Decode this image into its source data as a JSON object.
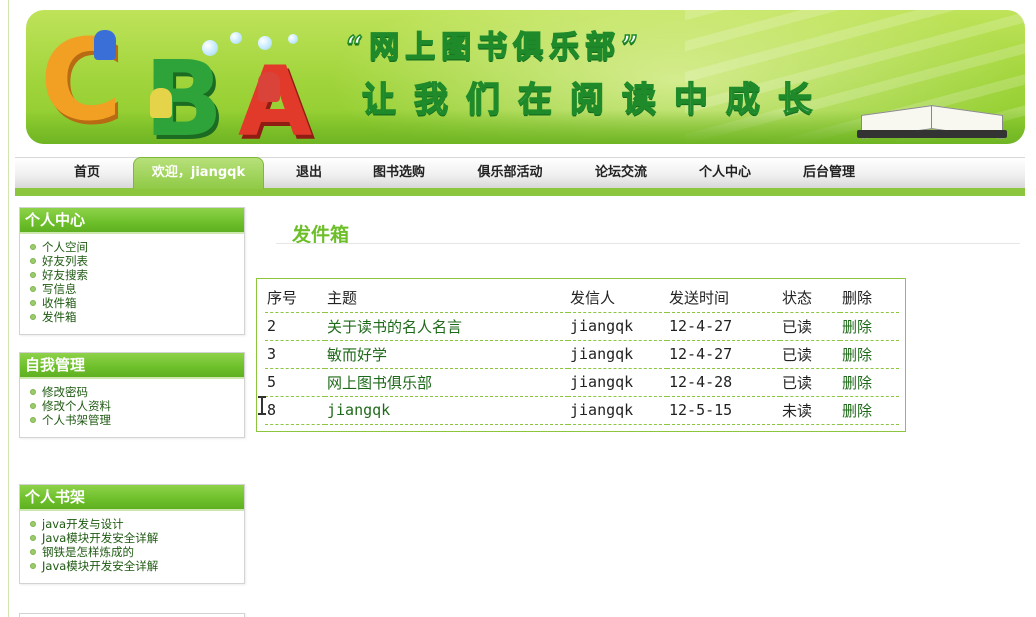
{
  "banner": {
    "title_line1": "“网上图书俱乐部”",
    "title_line2": "让我们在阅读中成长",
    "logo_letters": [
      "C",
      "B",
      "A"
    ],
    "colors": {
      "green": "#8cc63f",
      "letter_c": "#f1a023",
      "letter_b": "#2ea339",
      "letter_a": "#e23a2a"
    }
  },
  "nav": {
    "items": [
      {
        "label": "首页"
      },
      {
        "label": "欢迎，jiangqk",
        "active": true
      },
      {
        "label": "退出"
      },
      {
        "label": "图书选购"
      },
      {
        "label": "俱乐部活动"
      },
      {
        "label": "论坛交流"
      },
      {
        "label": "个人中心"
      },
      {
        "label": "后台管理"
      }
    ]
  },
  "sidebar": {
    "personal_center": {
      "title": "个人中心",
      "items": [
        "个人空间",
        "好友列表",
        "好友搜索",
        "写信息",
        "收件箱",
        "发件箱"
      ]
    },
    "self_management": {
      "title": "自我管理",
      "items": [
        "修改密码",
        "修改个人资料",
        "个人书架管理"
      ]
    },
    "bookshelf": {
      "title": "个人书架",
      "items": [
        "java开发与设计",
        "Java模块开发安全详解",
        "钢铁是怎样炼成的",
        "Java模块开发安全详解"
      ]
    }
  },
  "main": {
    "title": "发件箱",
    "table": {
      "headers": [
        "序号",
        "主题",
        "发信人",
        "发送时间",
        "状态",
        "删除"
      ],
      "rows": [
        {
          "id": "2",
          "subject": "关于读书的名人名言",
          "sender": "jiangqk",
          "time": "12-4-27",
          "status": "已读",
          "delete": "删除"
        },
        {
          "id": "3",
          "subject": "敏而好学",
          "sender": "jiangqk",
          "time": "12-4-27",
          "status": "已读",
          "delete": "删除"
        },
        {
          "id": "5",
          "subject": "网上图书俱乐部",
          "sender": "jiangqk",
          "time": "12-4-28",
          "status": "已读",
          "delete": "删除"
        },
        {
          "id": "8",
          "subject": "jiangqk",
          "sender": "jiangqk",
          "time": "12-5-15",
          "status": "未读",
          "delete": "删除"
        }
      ]
    }
  }
}
